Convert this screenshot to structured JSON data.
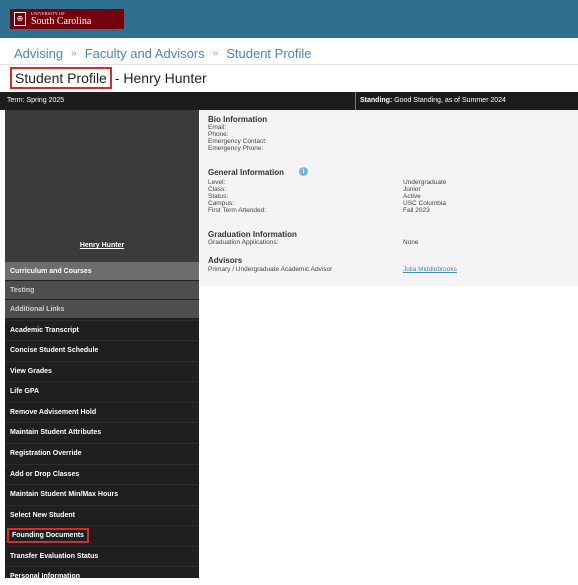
{
  "brand": {
    "small": "UNIVERSITY OF",
    "name": "South Carolina",
    "mark": "⊕"
  },
  "breadcrumb": [
    "Advising",
    "Faculty and Advisors",
    "Student Profile"
  ],
  "breadcrumb_sep": "»",
  "page": {
    "title_boxed": "Student Profile",
    "title_rest": "- Henry Hunter"
  },
  "infobar": {
    "term_label": "Term:",
    "term_value": "Spring 2025",
    "standing_label": "Standing:",
    "standing_value": "Good Standing, as of Summer 2024"
  },
  "student": {
    "name": "Henry Hunter"
  },
  "menu": {
    "headers": [
      "Curriculum and Courses",
      "Testing",
      "Additional Links"
    ],
    "links": [
      "Academic Transcript",
      "Concise Student Schedule",
      "View Grades",
      "Life GPA",
      "Remove Advisement Hold",
      "Maintain Student Attributes",
      "Registration Override",
      "Add or Drop Classes",
      "Maintain Student Min/Max Hours",
      "Select New Student",
      "Founding Documents",
      "Transfer Evaluation Status",
      "Personal Information"
    ]
  },
  "bio": {
    "heading": "Bio Information",
    "labels": [
      "Email:",
      "Phone:",
      "Emergency Contact:",
      "Emergency Phone:"
    ]
  },
  "general": {
    "heading": "General Information",
    "rows": [
      {
        "label": "Level:",
        "value": "Undergraduate"
      },
      {
        "label": "Class:",
        "value": "Junior"
      },
      {
        "label": "Status:",
        "value": "Active"
      },
      {
        "label": "Campus:",
        "value": "USC Columbia"
      },
      {
        "label": "First Term Attended:",
        "value": "Fall 2023"
      }
    ]
  },
  "graduation": {
    "heading": "Graduation Information",
    "label": "Graduation Applications:",
    "value": "None"
  },
  "advisors": {
    "heading": "Advisors",
    "label": "Primary / Undergraduate Academic Advisor",
    "value": "Julia Middlebrooks"
  },
  "colors": {
    "banner": "#2f6f8f",
    "brand": "#73000a",
    "highlight": "#d62c2c",
    "link": "#4a86b8"
  }
}
